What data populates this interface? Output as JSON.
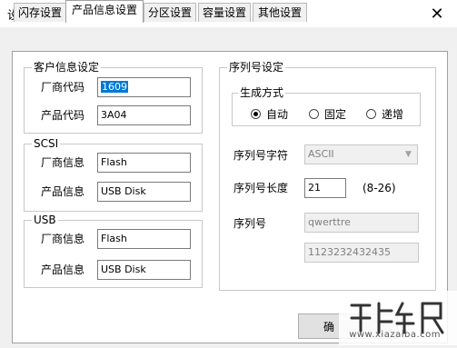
{
  "window": {
    "title": "设定",
    "close_glyph": "✕"
  },
  "tabs": [
    {
      "label": "闪存设置",
      "active": false
    },
    {
      "label": "产品信息设置",
      "active": true
    },
    {
      "label": "分区设置",
      "active": false
    },
    {
      "label": "容量设置",
      "active": false
    },
    {
      "label": "其他设置",
      "active": false
    }
  ],
  "customer": {
    "title": "客户信息设定",
    "vendor_code_label": "厂商代码",
    "vendor_code_value": "1609",
    "product_code_label": "产品代码",
    "product_code_value": "3A04"
  },
  "scsi": {
    "title": "SCSI",
    "vendor_label": "厂商信息",
    "vendor_value": "Flash",
    "product_label": "产品信息",
    "product_value": "USB Disk"
  },
  "usb": {
    "title": "USB",
    "vendor_label": "厂商信息",
    "vendor_value": "Flash",
    "product_label": "产品信息",
    "product_value": "USB Disk"
  },
  "serial": {
    "title": "序列号设定",
    "gen_title": "生成方式",
    "gen_options": [
      "自动",
      "固定",
      "递增"
    ],
    "gen_selected": "自动",
    "charset_label": "序列号字符",
    "charset_value": "ASCII",
    "length_label": "序列号长度",
    "length_value": "21",
    "length_range": "(8-26)",
    "serial_label": "序列号",
    "serial_value": "qwerttre",
    "serial_value2": "1123232432435"
  },
  "buttons": {
    "ok_label": "确"
  },
  "watermark": {
    "text": "www.xiazaiba.com"
  }
}
